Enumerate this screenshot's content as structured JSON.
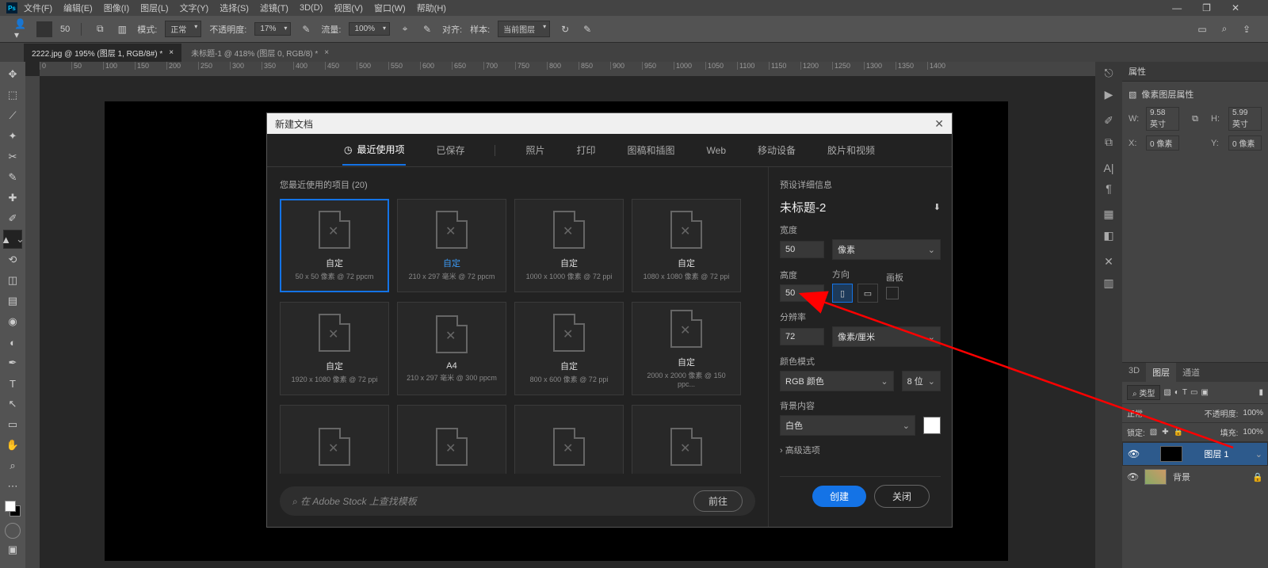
{
  "menu": {
    "items": [
      "文件(F)",
      "编辑(E)",
      "图像(I)",
      "图层(L)",
      "文字(Y)",
      "选择(S)",
      "滤镜(T)",
      "3D(D)",
      "视图(V)",
      "窗口(W)",
      "帮助(H)"
    ]
  },
  "options": {
    "size": "50",
    "mode_lbl": "模式:",
    "mode": "正常",
    "opacity_lbl": "不透明度:",
    "opacity": "17%",
    "flow_lbl": "流量:",
    "flow": "100%",
    "align_lbl": "对齐:",
    "sample_lbl": "样本:",
    "sample": "当前图层"
  },
  "docs": [
    {
      "label": "2222.jpg @ 195% (图层 1, RGB/8#) *",
      "active": true
    },
    {
      "label": "未标题-1 @ 418% (图层 0, RGB/8) *",
      "active": false
    }
  ],
  "ruler": [
    "0",
    "50",
    "100",
    "150",
    "200",
    "250",
    "300",
    "350",
    "400",
    "450",
    "500",
    "550",
    "600",
    "650",
    "700",
    "750",
    "800",
    "850",
    "900",
    "950",
    "1000",
    "1050",
    "1100",
    "1150",
    "1200",
    "1250",
    "1300",
    "1350",
    "1400"
  ],
  "props": {
    "title": "属性",
    "kind": "像素图层属性",
    "w_lbl": "W:",
    "w": "9.58 英寸",
    "h_lbl": "H:",
    "h": "5.99 英寸",
    "x_lbl": "X:",
    "x": "0 像素",
    "y_lbl": "Y:",
    "y": "0 像素"
  },
  "layers": {
    "tabs": [
      "3D",
      "图层",
      "通道"
    ],
    "kind": "⌕ 类型",
    "blend": "正常",
    "opacity_lbl": "不透明度:",
    "opacity": "100%",
    "lock_lbl": "锁定:",
    "fill_lbl": "填充:",
    "fill": "100%",
    "items": [
      {
        "name": "图层 1",
        "sel": true,
        "locked": false,
        "thumb": "black"
      },
      {
        "name": "背景",
        "sel": false,
        "locked": true,
        "thumb": "bg"
      }
    ]
  },
  "modal": {
    "title": "新建文档",
    "tabs": [
      "最近使用项",
      "已保存",
      "照片",
      "打印",
      "图稿和插图",
      "Web",
      "移动设备",
      "胶片和视频"
    ],
    "recent_header": "您最近使用的项目  (20)",
    "presets": [
      {
        "name": "自定",
        "sub": "50 x 50 像素 @ 72 ppcm",
        "sel": true,
        "blue": false
      },
      {
        "name": "自定",
        "sub": "210 x 297 毫米 @ 72 ppcm",
        "sel": false,
        "blue": true
      },
      {
        "name": "自定",
        "sub": "1000 x 1000 像素 @ 72 ppi",
        "sel": false,
        "blue": false
      },
      {
        "name": "自定",
        "sub": "1080 x 1080 像素 @ 72 ppi",
        "sel": false,
        "blue": false
      },
      {
        "name": "自定",
        "sub": "1920 x 1080 像素 @ 72 ppi",
        "sel": false,
        "blue": false
      },
      {
        "name": "A4",
        "sub": "210 x 297 毫米 @ 300 ppcm",
        "sel": false,
        "blue": false
      },
      {
        "name": "自定",
        "sub": "800 x 600 像素 @ 72 ppi",
        "sel": false,
        "blue": false
      },
      {
        "name": "自定",
        "sub": "2000 x 2000 像素 @ 150 ppc...",
        "sel": false,
        "blue": false
      },
      {
        "name": "",
        "sub": "",
        "sel": false,
        "blue": false
      },
      {
        "name": "",
        "sub": "",
        "sel": false,
        "blue": false
      },
      {
        "name": "",
        "sub": "",
        "sel": false,
        "blue": false
      },
      {
        "name": "",
        "sub": "",
        "sel": false,
        "blue": false
      }
    ],
    "stock_placeholder": "在 Adobe Stock 上查找模板",
    "stock_go": "前往",
    "details": {
      "section": "预设详细信息",
      "name": "未标题-2",
      "width_lbl": "宽度",
      "width": "50",
      "width_unit": "像素",
      "height_lbl": "高度",
      "height": "50",
      "orient_lbl": "方向",
      "artboard_lbl": "画板",
      "res_lbl": "分辨率",
      "res": "72",
      "res_unit": "像素/厘米",
      "mode_lbl": "颜色模式",
      "mode": "RGB 颜色",
      "bits": "8 位",
      "bg_lbl": "背景内容",
      "bg": "白色",
      "adv": "高级选项"
    },
    "create": "创建",
    "close": "关闭"
  }
}
